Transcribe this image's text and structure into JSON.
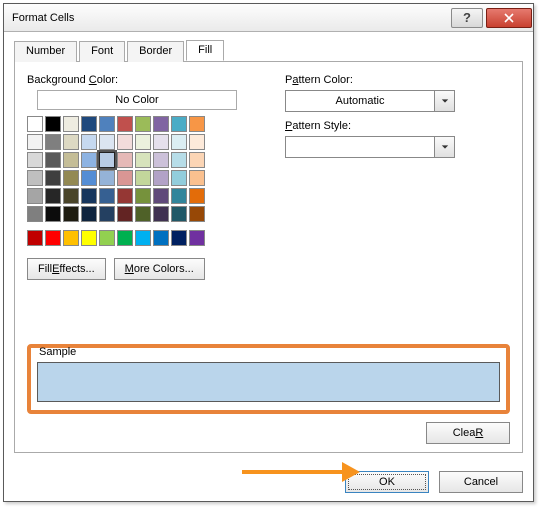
{
  "window": {
    "title": "Format Cells"
  },
  "tabs": {
    "number": "Number",
    "font": "Font",
    "border": "Border",
    "fill": "Fill",
    "active": "fill"
  },
  "fill": {
    "bg_label_pre": "Background ",
    "bg_label_u": "C",
    "bg_label_post": "olor:",
    "no_color": "No Color",
    "effects_pre": "Fill ",
    "effects_u": "E",
    "effects_post": "ffects...",
    "more_u": "M",
    "more_post": "ore Colors...",
    "theme_colors": [
      [
        "#FFFFFF",
        "#000000",
        "#EEECE1",
        "#1F497D",
        "#4F81BD",
        "#C0504D",
        "#9BBB59",
        "#8064A2",
        "#4BACC6",
        "#F79646"
      ],
      [
        "#F2F2F2",
        "#7F7F7F",
        "#DDD9C3",
        "#C6D9F0",
        "#DBE5F1",
        "#F2DCDB",
        "#EBF1DD",
        "#E5E0EC",
        "#DBEEF3",
        "#FDEADA"
      ],
      [
        "#D8D8D8",
        "#595959",
        "#C4BD97",
        "#8DB3E2",
        "#B8CCE4",
        "#E5B9B7",
        "#D7E3BC",
        "#CCC1D9",
        "#B7DDE8",
        "#FBD5B5"
      ],
      [
        "#BFBFBF",
        "#3F3F3F",
        "#938953",
        "#548DD4",
        "#95B3D7",
        "#D99694",
        "#C3D69B",
        "#B2A2C7",
        "#92CDDC",
        "#FAC08F"
      ],
      [
        "#A5A5A5",
        "#262626",
        "#494429",
        "#17365D",
        "#366092",
        "#953734",
        "#76923C",
        "#5F497A",
        "#31859B",
        "#E36C09"
      ],
      [
        "#7F7F7F",
        "#0C0C0C",
        "#1D1B10",
        "#0F243E",
        "#244061",
        "#632423",
        "#4F6128",
        "#3F3151",
        "#205867",
        "#974806"
      ]
    ],
    "standard_colors": [
      "#C00000",
      "#FF0000",
      "#FFC000",
      "#FFFF00",
      "#92D050",
      "#00B050",
      "#00B0F0",
      "#0070C0",
      "#002060",
      "#7030A0"
    ],
    "selected": {
      "row": 2,
      "col": 4
    }
  },
  "pattern": {
    "color_label_pre": "P",
    "color_label_u": "a",
    "color_label_post": "ttern Color:",
    "color_value": "Automatic",
    "style_label_pre": "",
    "style_label_u": "P",
    "style_label_post": "attern Style:",
    "style_value": ""
  },
  "sample": {
    "label": "Sample",
    "color": "#BAD5EB"
  },
  "buttons": {
    "clear_u": "R",
    "clear_pre": "Clea",
    "ok": "OK",
    "cancel": "Cancel"
  }
}
